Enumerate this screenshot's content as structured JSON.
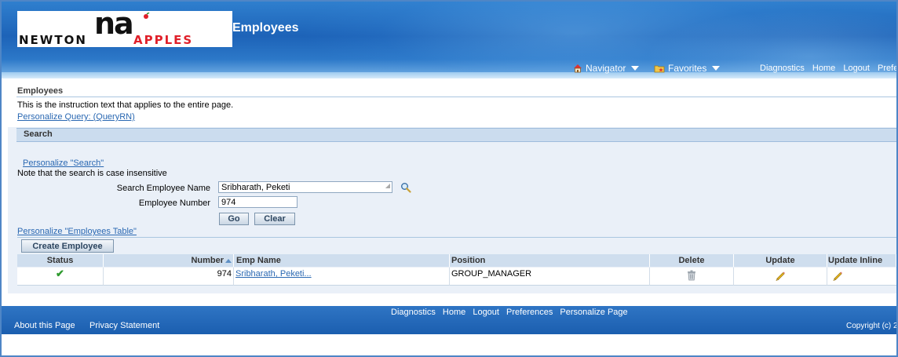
{
  "header": {
    "logo_na": "na",
    "logo_newton": "NEWTON",
    "logo_apples": "APPLES",
    "app_title": "Employees",
    "navigator_label": "Navigator",
    "favorites_label": "Favorites",
    "global_links": [
      "Diagnostics",
      "Home",
      "Logout",
      "Prefer"
    ]
  },
  "page": {
    "heading": "Employees",
    "instruction": "This is the instruction text that applies to the entire page.",
    "personalize_query": "Personalize Query: (QueryRN)"
  },
  "search": {
    "header": "Search",
    "personalize_search": "Personalize \"Search\"",
    "note": "Note that the search is case insensitive",
    "employee_name_label": "Search Employee Name",
    "employee_name_value": "Sribharath, Peketi",
    "employee_number_label": "Employee Number",
    "employee_number_value": "974",
    "go_label": "Go",
    "clear_label": "Clear"
  },
  "table": {
    "personalize_table": "Personalize \"Employees Table\"",
    "create_label": "Create Employee",
    "columns": [
      "Status",
      "Number",
      "Emp Name",
      "Position",
      "Delete",
      "Update",
      "Update Inline"
    ],
    "rows": [
      {
        "status": "✔",
        "number": "974",
        "emp_name": "Sribharath, Peketi...",
        "position": "GROUP_MANAGER"
      }
    ]
  },
  "footer": {
    "links": [
      "Diagnostics",
      "Home",
      "Logout",
      "Preferences",
      "Personalize Page"
    ],
    "about": "About this Page",
    "privacy": "Privacy Statement",
    "copyright": "Copyright (c) 2"
  },
  "colors": {
    "header_blue": "#1d63b8",
    "link_blue": "#2a68b2",
    "logo_red": "#e0202a",
    "status_green": "#2e9a2e",
    "pencil_yellow": "#e8b91e"
  },
  "icons": {
    "navigator": "home-icon",
    "favorites": "folder-star-icon",
    "search": "magnifier-icon",
    "status": "checkmark-icon",
    "delete": "trash-icon",
    "update": "pencil-icon"
  }
}
